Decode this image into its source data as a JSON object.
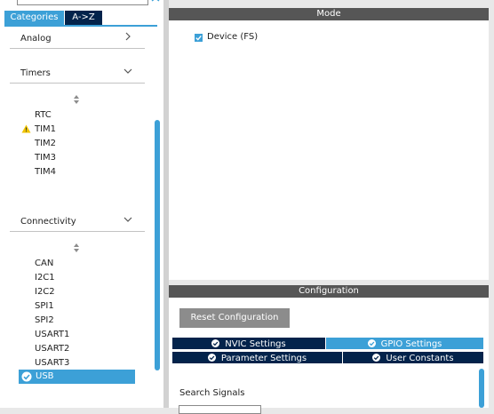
{
  "left_panel": {
    "tabs": {
      "categories": "Categories",
      "az": "A->Z"
    },
    "sections": {
      "analog": "Analog",
      "timers": "Timers",
      "connectivity": "Connectivity"
    },
    "timers_items": [
      "RTC",
      "TIM1",
      "TIM2",
      "TIM3",
      "TIM4"
    ],
    "connectivity_items": [
      "CAN",
      "I2C1",
      "I2C2",
      "SPI1",
      "SPI2",
      "USART1",
      "USART2",
      "USART3",
      "USB"
    ],
    "selected_item": "USB",
    "warning_item": "TIM1"
  },
  "mode_panel": {
    "title": "Mode",
    "device_fs_label": "Device (FS)",
    "device_fs_checked": true
  },
  "configuration_panel": {
    "title": "Configuration",
    "reset_button": "Reset Configuration",
    "tabs": {
      "nvic": "NVIC Settings",
      "gpio": "GPIO Settings",
      "parameter": "Parameter Settings",
      "user_constants": "User Constants"
    },
    "selected_tab": "GPIO Settings",
    "search_label": "Search Signals"
  },
  "colors": {
    "accent": "#3ca0d7",
    "dark_navy": "#03234b",
    "header_gray": "#565656",
    "button_gray": "#8c8c8c",
    "warning": "#f0c400"
  }
}
